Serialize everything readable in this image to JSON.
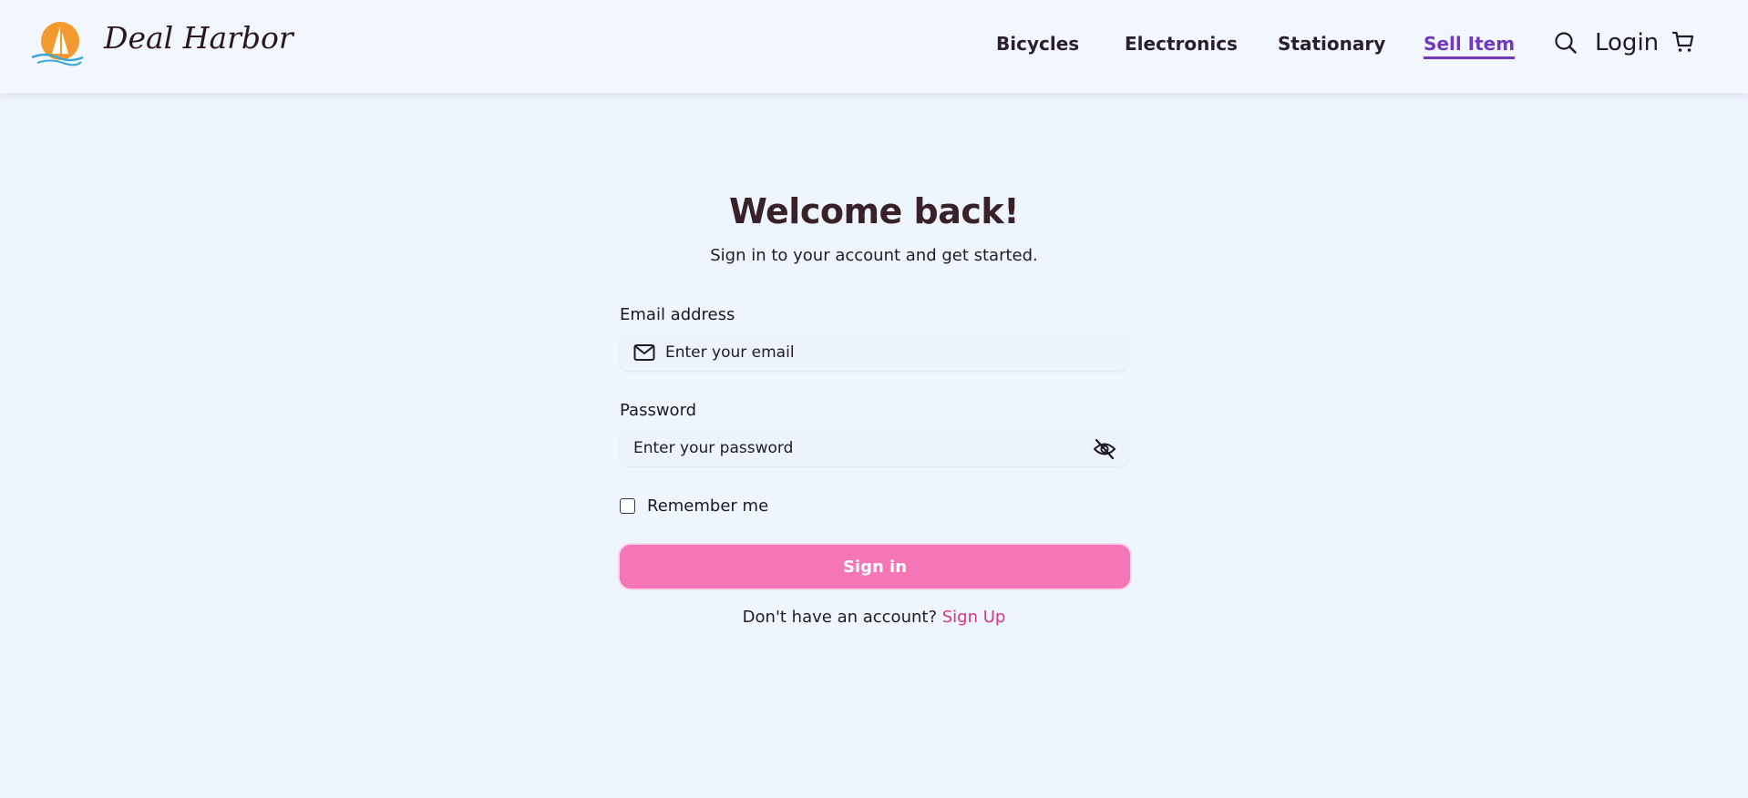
{
  "brand": {
    "name": "Deal Harbor",
    "logo_icon": "sailboat-sun-logo",
    "logo_sun_color": "#f39a2f",
    "logo_wave_color": "#3aa8d8"
  },
  "nav": {
    "items": [
      {
        "label": "Bicycles",
        "active": false
      },
      {
        "label": "Electronics",
        "active": false
      },
      {
        "label": "Stationary",
        "active": false
      },
      {
        "label": "Sell Item",
        "active": true
      }
    ],
    "active_color": "#7239be",
    "search_icon": "search-icon",
    "login_label": "Login",
    "cart_icon": "cart-icon"
  },
  "login": {
    "title": "Welcome back!",
    "subtitle": "Sign in to your account and get started.",
    "email": {
      "label": "Email address",
      "placeholder": "Enter your email",
      "value": "",
      "icon": "mail-icon"
    },
    "password": {
      "label": "Password",
      "placeholder": "Enter your password",
      "value": "",
      "icon": "eye-off-icon"
    },
    "remember_me": {
      "label": "Remember me",
      "checked": false
    },
    "submit_label": "Sign in",
    "submit_color": "#f476b6",
    "signup_prompt": "Don't have an account?",
    "signup_link": "Sign Up",
    "signup_link_color": "#d8368a"
  }
}
